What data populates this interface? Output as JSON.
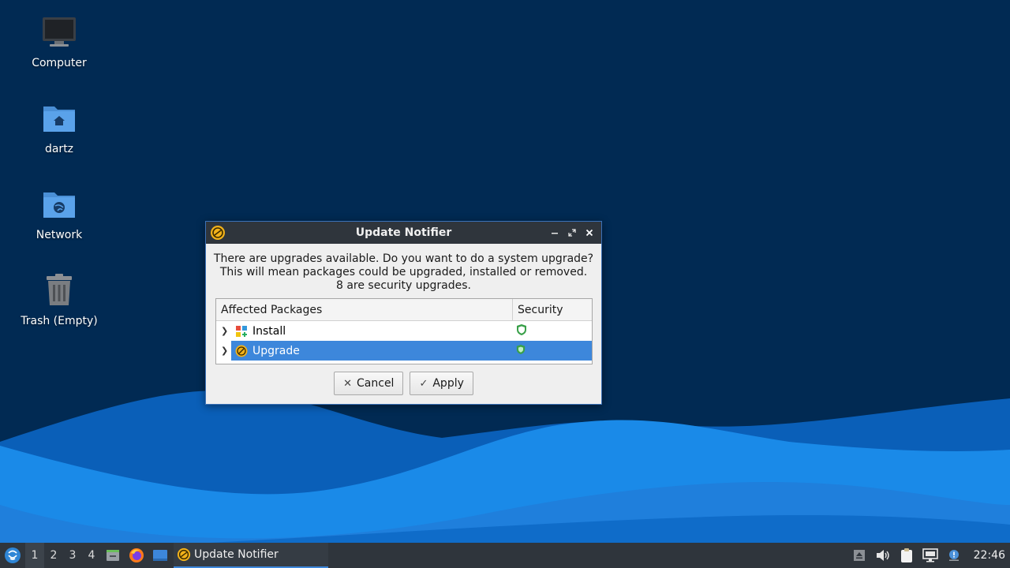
{
  "desktop": {
    "icons": [
      {
        "label": "Computer"
      },
      {
        "label": "dartz"
      },
      {
        "label": "Network"
      },
      {
        "label": "Trash (Empty)"
      }
    ]
  },
  "dialog": {
    "title": "Update Notifier",
    "message_lines": [
      "There are upgrades available. Do you want to do a system upgrade?",
      "This will mean packages could be upgraded, installed or removed.",
      "8 are security upgrades."
    ],
    "table": {
      "columns": [
        "Affected Packages",
        "Security"
      ],
      "rows": [
        {
          "name": "Install",
          "security_icon": "shield-icon",
          "selected": false
        },
        {
          "name": "Upgrade",
          "security_icon": "shield-icon",
          "selected": true
        }
      ]
    },
    "buttons": {
      "cancel": "Cancel",
      "apply": "Apply"
    }
  },
  "taskbar": {
    "workspaces": [
      "1",
      "2",
      "3",
      "4"
    ],
    "active_workspace": "1",
    "task_label": "Update Notifier",
    "clock": "22:46"
  },
  "colors": {
    "desktop_bg": "#012a53",
    "accent": "#3d87db",
    "panel": "#2f353c",
    "shield_green": "#3aa04a"
  }
}
